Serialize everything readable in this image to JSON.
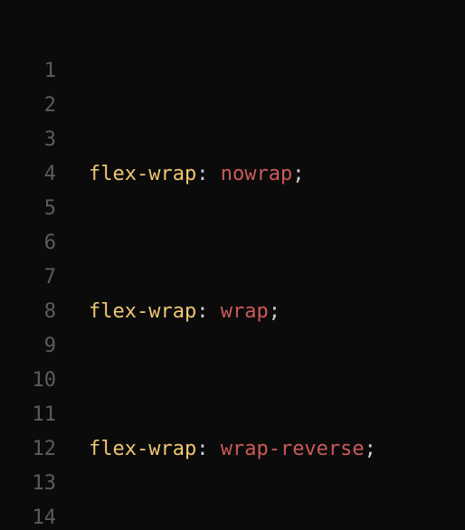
{
  "editor": {
    "line_numbers": [
      "1",
      "2",
      "3",
      "4",
      "5",
      "6",
      "7",
      "8",
      "9",
      "10",
      "11",
      "12",
      "13",
      "14"
    ],
    "lines": {
      "3": {
        "property": "flex-wrap",
        "colon": ":",
        "value": "nowrap",
        "semicolon": ";"
      },
      "7": {
        "property": "flex-wrap",
        "colon": ":",
        "value": "wrap",
        "semicolon": ";"
      },
      "11": {
        "property": "flex-wrap",
        "colon": ":",
        "value": "wrap-reverse",
        "semicolon": ";"
      }
    },
    "colors": {
      "background": "#0b0b0b",
      "line_number": "#5c5c5c",
      "property": "#f0c674",
      "punctuation": "#cfcfcf",
      "value": "#cc5a5a"
    }
  }
}
